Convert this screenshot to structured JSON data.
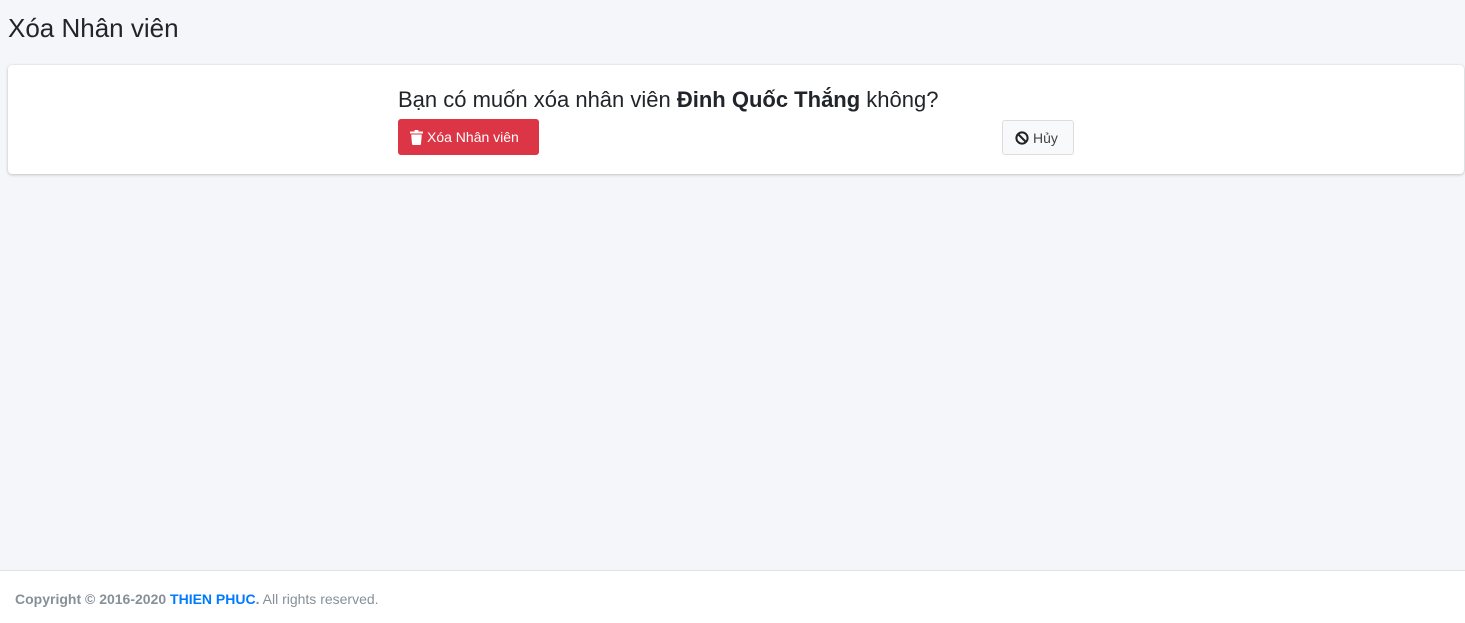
{
  "header": {
    "title": "Xóa Nhân viên"
  },
  "confirm": {
    "question_prefix": "Bạn có muốn xóa nhân viên ",
    "employee_name": "Đinh Quốc Thắng",
    "question_suffix": " không?"
  },
  "buttons": {
    "delete_label": "Xóa Nhân viên",
    "delete_icon": "trash-icon",
    "cancel_label": "Hủy",
    "cancel_icon": "ban-icon"
  },
  "footer": {
    "copyright_prefix": "Copyright © 2016-2020 ",
    "company_link": "THIEN PHUC",
    "period": ".",
    "rights": " All rights reserved."
  },
  "colors": {
    "danger": "#dc3545",
    "link": "#007bff",
    "background": "#f4f6f9"
  }
}
